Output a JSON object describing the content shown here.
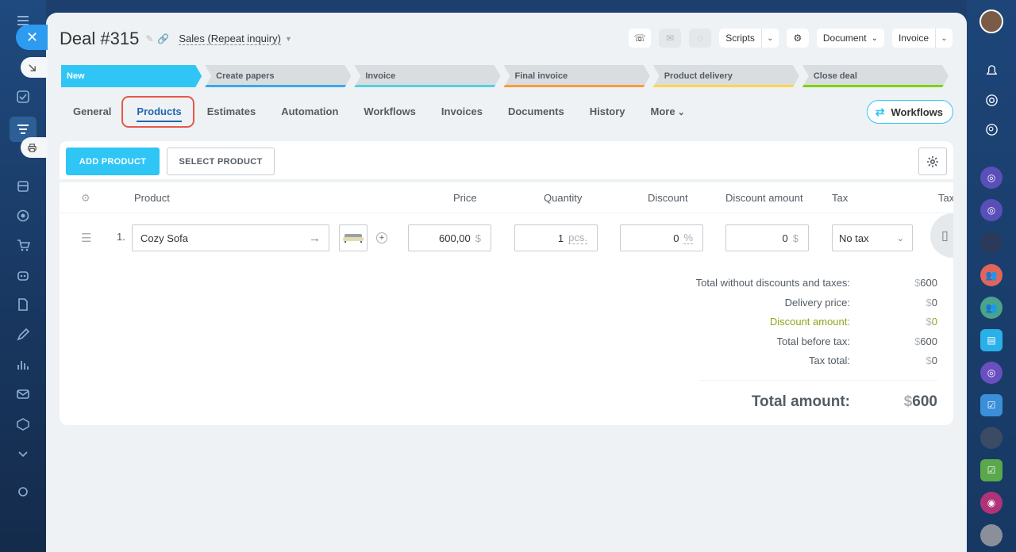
{
  "deal": {
    "title": "Deal #315",
    "pipeline": "Sales (Repeat inquiry)"
  },
  "header_actions": {
    "scripts": "Scripts",
    "document": "Document",
    "invoice": "Invoice"
  },
  "stages": [
    {
      "label": "New",
      "color": "#2fc6f6"
    },
    {
      "label": "Create papers",
      "color": "#39a8ef"
    },
    {
      "label": "Invoice",
      "color": "#55d0e0"
    },
    {
      "label": "Final invoice",
      "color": "#ff9a3c"
    },
    {
      "label": "Product delivery",
      "color": "#ffd64a"
    },
    {
      "label": "Close deal",
      "color": "#7bd500"
    }
  ],
  "tabs": [
    "General",
    "Products",
    "Estimates",
    "Automation",
    "Workflows",
    "Invoices",
    "Documents",
    "History",
    "More"
  ],
  "workflows_button": "Workflows",
  "products": {
    "add_label": "ADD PRODUCT",
    "select_label": "SELECT PRODUCT",
    "columns": {
      "product": "Product",
      "price": "Price",
      "quantity": "Quantity",
      "discount": "Discount",
      "discount_amount": "Discount amount",
      "tax": "Tax",
      "tax_cut": "Tax"
    },
    "rows": [
      {
        "num": "1.",
        "name": "Cozy Sofa",
        "price": "600,00",
        "currency": "$",
        "quantity": "1",
        "unit": "pcs.",
        "discount": "0",
        "discount_unit": "%",
        "discount_amount": "0",
        "tax": "No tax"
      }
    ]
  },
  "totals": {
    "without_label": "Total without discounts and taxes:",
    "without_value": "600",
    "delivery_label": "Delivery price:",
    "delivery_value": "0",
    "discount_label": "Discount amount:",
    "discount_value": "0",
    "before_tax_label": "Total before tax:",
    "before_tax_value": "600",
    "tax_label": "Tax total:",
    "tax_value": "0",
    "amount_label": "Total amount:",
    "amount_value": "600",
    "currency": "$"
  }
}
